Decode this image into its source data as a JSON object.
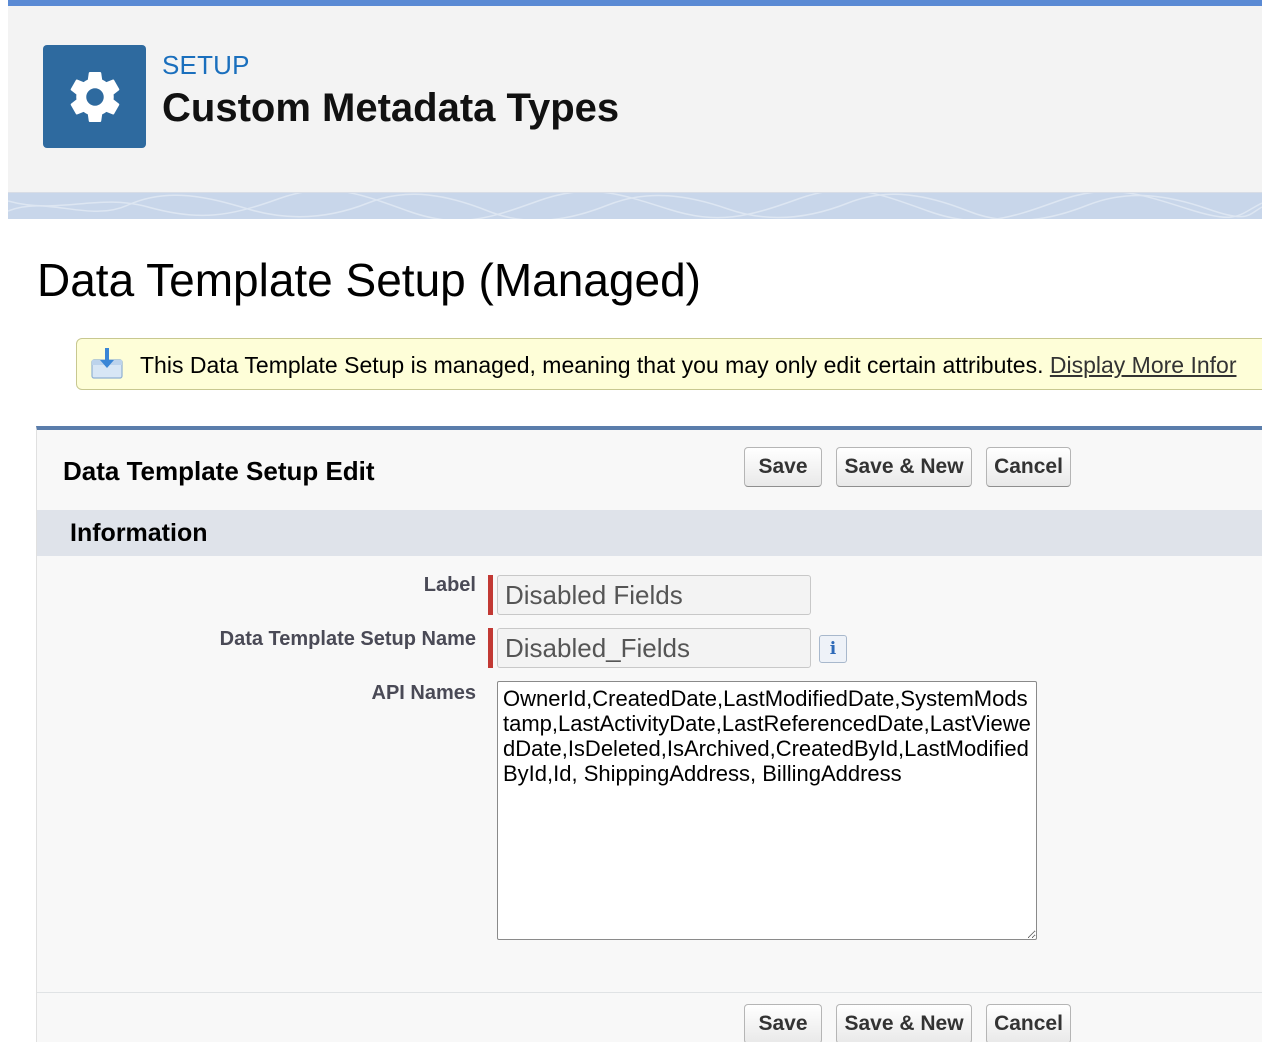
{
  "header": {
    "eyebrow": "SETUP",
    "title": "Custom Metadata Types",
    "icon": "gear-icon",
    "icon_bg": "#2e6a9f"
  },
  "page": {
    "title": "Data Template Setup (Managed)"
  },
  "notice": {
    "icon": "managed-package-icon",
    "text": "This Data Template Setup is managed, meaning that you may only edit certain attributes.",
    "link": "Display More Infor"
  },
  "form": {
    "title": "Data Template Setup Edit",
    "buttons": {
      "save": "Save",
      "save_new": "Save & New",
      "cancel": "Cancel"
    },
    "section_title": "Information",
    "fields": {
      "label": {
        "label": "Label",
        "value": "Disabled Fields"
      },
      "name": {
        "label": "Data Template Setup Name",
        "value": "Disabled_Fields"
      },
      "api_names": {
        "label": "API Names",
        "value": "OwnerId,CreatedDate,LastModifiedDate,SystemModstamp,LastActivityDate,LastReferencedDate,LastViewedDate,IsDeleted,IsArchived,CreatedById,LastModifiedById,Id, ShippingAddress, BillingAddress"
      }
    }
  },
  "colors": {
    "brand": "#2e6a9f",
    "required": "#c23934",
    "link": "#1a6fbd"
  }
}
